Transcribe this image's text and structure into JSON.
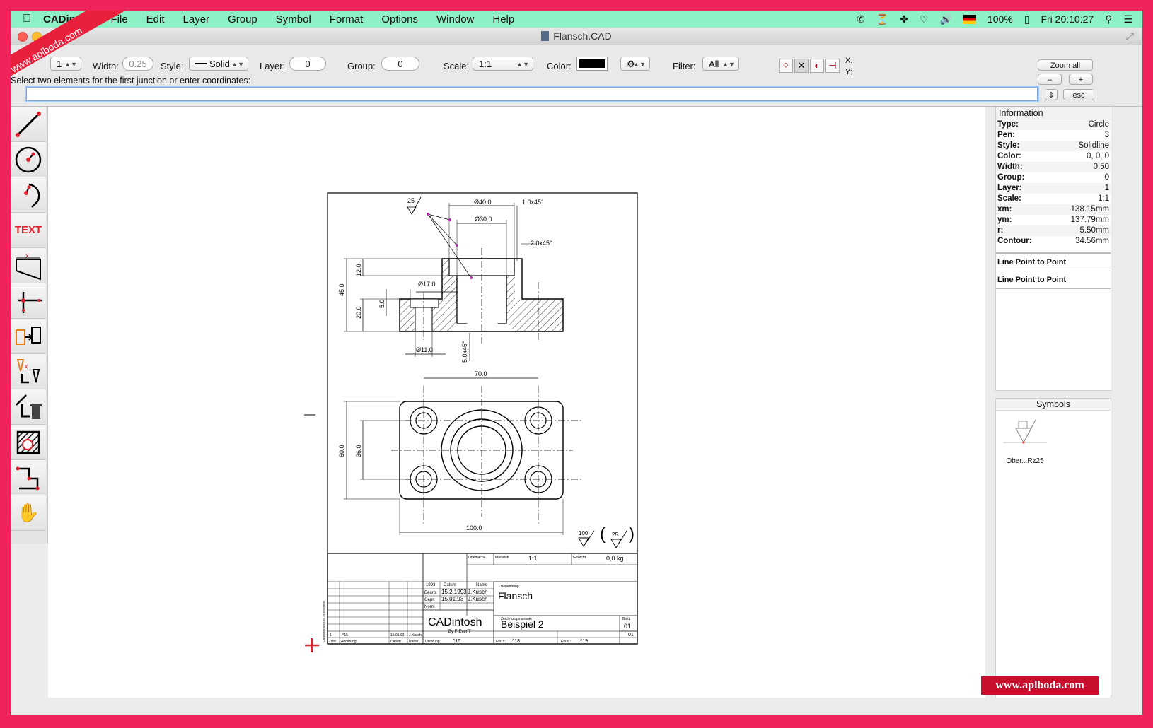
{
  "menubar": {
    "app_name": "CADintosh",
    "items": [
      "File",
      "Edit",
      "Layer",
      "Group",
      "Symbol",
      "Format",
      "Options",
      "Window",
      "Help"
    ],
    "battery": "100%",
    "clock": "Fri 20:10:27"
  },
  "window": {
    "title": "Flansch.CAD"
  },
  "toolbar": {
    "pen_value": "1",
    "width_label": "Width:",
    "width_value": "0.25",
    "style_label": "Style:",
    "style_value": "Solid",
    "layer_label": "Layer:",
    "layer_value": "0",
    "group_label": "Group:",
    "group_value": "0",
    "scale_label": "Scale:",
    "scale_value": "1:1",
    "color_label": "Color:",
    "color_value": "#000000",
    "filter_label": "Filter:",
    "filter_value": "All",
    "x_label": "X:",
    "y_label": "Y:",
    "zoom_all": "Zoom all",
    "zoom_out": "–",
    "zoom_in": "+",
    "esc": "esc"
  },
  "prompt": "Select two elements for the first junction or enter coordinates:",
  "command_input": "",
  "tools": [
    {
      "name": "line-tool-icon"
    },
    {
      "name": "circle-tool-icon"
    },
    {
      "name": "arc-tool-icon"
    },
    {
      "name": "text-tool-icon",
      "text": "TEXT"
    },
    {
      "name": "dimension-tool-icon"
    },
    {
      "name": "junction-tool-icon"
    },
    {
      "name": "copy-tool-icon"
    },
    {
      "name": "edit-tool-icon"
    },
    {
      "name": "delete-tool-icon"
    },
    {
      "name": "hatch-tool-icon"
    },
    {
      "name": "polyline-tool-icon"
    },
    {
      "name": "hand-tool-icon"
    }
  ],
  "information": {
    "title": "Information",
    "rows": [
      {
        "k": "Type:",
        "v": "Circle"
      },
      {
        "k": "Pen:",
        "v": "3"
      },
      {
        "k": "Style:",
        "v": "Solidline"
      },
      {
        "k": "Color:",
        "v": "0, 0, 0"
      },
      {
        "k": "Width:",
        "v": "0.50"
      },
      {
        "k": "Group:",
        "v": "0"
      },
      {
        "k": "Layer:",
        "v": "1"
      },
      {
        "k": "Scale:",
        "v": "1:1"
      },
      {
        "k": "xm:",
        "v": "138.15mm"
      },
      {
        "k": "ym:",
        "v": "137.79mm"
      },
      {
        "k": "r:",
        "v": "5.50mm"
      },
      {
        "k": "Contour:",
        "v": "34.56mm"
      }
    ],
    "extra": [
      "Line Point to Point",
      "Line Point to Point"
    ]
  },
  "symbols": {
    "title": "Symbols",
    "items": [
      {
        "label": "Ober...Rz25"
      }
    ]
  },
  "drawing": {
    "dims_top": {
      "d40": "Ø40.0",
      "d30": "Ø30.0",
      "chamfer1": "1.0x45°",
      "chamfer2": "2.0x45°",
      "rough": "25",
      "d17": "Ø17.0",
      "d11": "Ø11.0",
      "h45": "45.0",
      "h12": "12.0",
      "h20": "20.0",
      "h5": "5.0",
      "chamfer3": "5.0x45°"
    },
    "dims_bottom": {
      "w70": "70.0",
      "w100": "100.0",
      "h60": "60.0",
      "h36": "36.0"
    },
    "surface": {
      "r1": "100",
      "r2": "25"
    },
    "title_block": {
      "surface_lbl": "Oberfläche",
      "scale_lbl": "Maßstab",
      "scale": "1:1",
      "weight_lbl": "Gewicht",
      "weight": "0,0 kg",
      "year": "1993",
      "date_lbl": "Datum",
      "name_lbl": "Name",
      "bearb": "Bearb.",
      "bearb_date": "15.2.1993",
      "bearb_name": "J.Kusch",
      "gepr": "Gepr.",
      "gepr_date": "15.01.93",
      "gepr_name": "J.Kusch",
      "norm": "Norm",
      "benennung_lbl": "Benennung",
      "benennung": "Flansch",
      "company": "CADintosh",
      "company_sub": "By F-EvenT",
      "zeichnr_lbl": "Zeichnungsnummer",
      "zeichnr": "Beispiel 2",
      "blatt_lbl": "Blatt",
      "blatt": "01",
      "blatt2": "01",
      "rev_row": [
        "1",
        "^15",
        "15.01.93",
        "J.Kusch"
      ],
      "foot": [
        "Zust.",
        "Änderung",
        "Datum",
        "Name",
        "Ursprung",
        "^16",
        "Ers. f.:",
        "^18",
        "Ers.d.:",
        "^19"
      ],
      "copyright": "Copyright nach DIN 34 beachten"
    }
  },
  "watermark": "www.aplboda.com"
}
